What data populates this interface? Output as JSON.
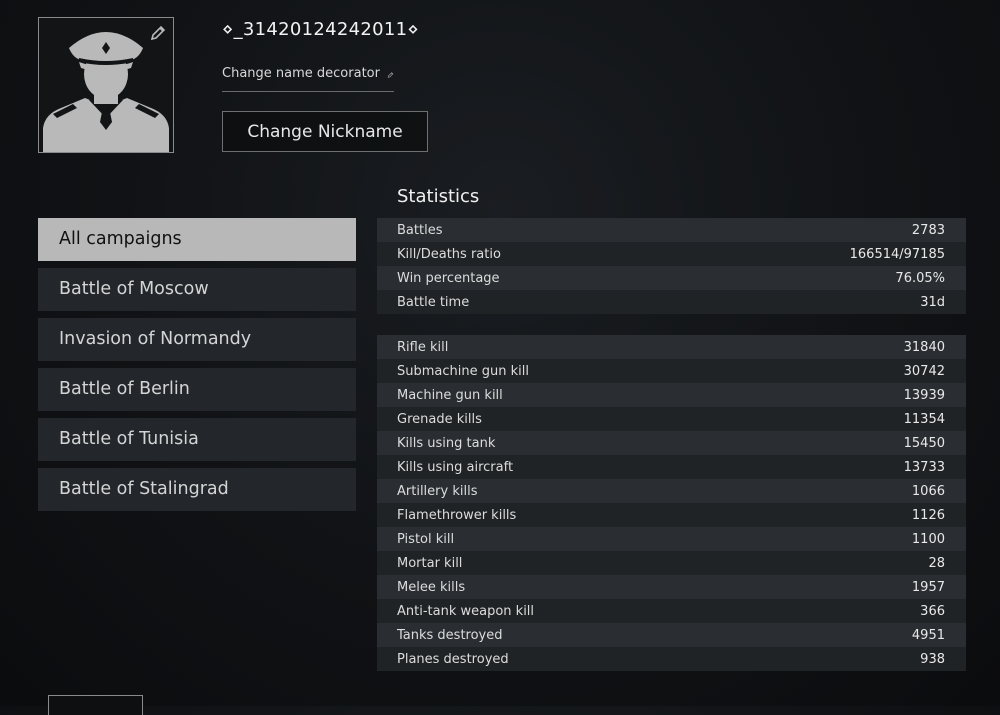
{
  "profile": {
    "nickname": "⋄_31420124242011⋄",
    "change_decorator_label": "Change name decorator",
    "change_nickname_label": "Change Nickname",
    "icons": {
      "avatar": "soldier-avatar-icon",
      "edit": "pencil-icon"
    }
  },
  "campaigns": {
    "items": [
      {
        "label": "All campaigns",
        "active": true
      },
      {
        "label": "Battle of Moscow",
        "active": false
      },
      {
        "label": "Invasion of Normandy",
        "active": false
      },
      {
        "label": "Battle of Berlin",
        "active": false
      },
      {
        "label": "Battle of Tunisia",
        "active": false
      },
      {
        "label": "Battle of Stalingrad",
        "active": false
      }
    ]
  },
  "statistics": {
    "title": "Statistics",
    "general": [
      {
        "label": "Battles",
        "value": "2783"
      },
      {
        "label": "Kill/Deaths ratio",
        "value": "166514/97185"
      },
      {
        "label": "Win percentage",
        "value": "76.05%"
      },
      {
        "label": "Battle time",
        "value": "31d"
      }
    ],
    "kills": [
      {
        "label": "Rifle kill",
        "value": "31840"
      },
      {
        "label": "Submachine gun kill",
        "value": "30742"
      },
      {
        "label": "Machine gun kill",
        "value": "13939"
      },
      {
        "label": "Grenade kills",
        "value": "11354"
      },
      {
        "label": "Kills using tank",
        "value": "15450"
      },
      {
        "label": "Kills using aircraft",
        "value": "13733"
      },
      {
        "label": "Artillery kills",
        "value": "1066"
      },
      {
        "label": "Flamethrower kills",
        "value": "1126"
      },
      {
        "label": "Pistol kill",
        "value": "1100"
      },
      {
        "label": "Mortar kill",
        "value": "28"
      },
      {
        "label": "Melee kills",
        "value": "1957"
      },
      {
        "label": "Anti-tank weapon kill",
        "value": "366"
      },
      {
        "label": "Tanks destroyed",
        "value": "4951"
      },
      {
        "label": "Planes destroyed",
        "value": "938"
      }
    ]
  },
  "colors": {
    "background": "#101215",
    "row_odd": "#2a2e32",
    "row_even": "#202326",
    "campaign_active": "#b8b8b8",
    "campaign_inactive": "#23272b"
  }
}
